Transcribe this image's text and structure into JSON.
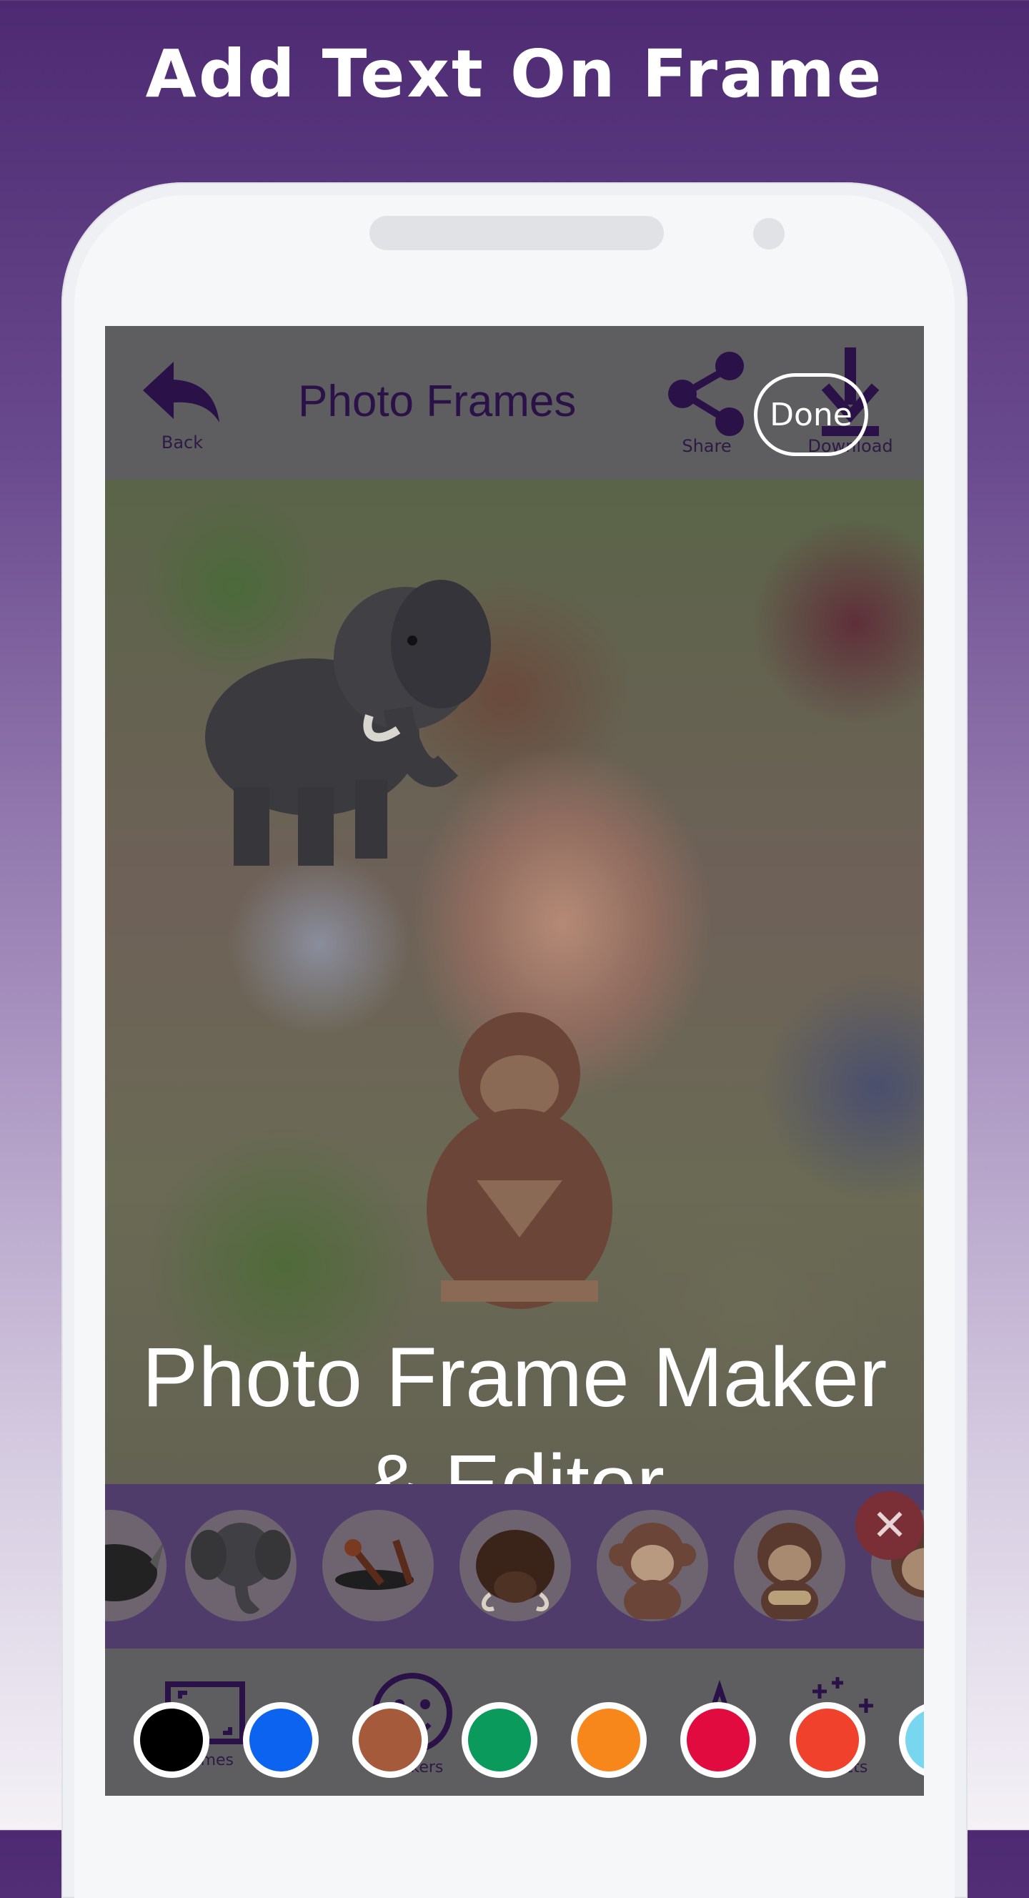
{
  "headline": "Add Text On Frame",
  "app": {
    "title": "Photo Frames",
    "back_label": "Back",
    "share_label": "Share",
    "download_label": "Download",
    "done_label": "Done"
  },
  "overlay_text": {
    "line1": "Photo Frame Maker",
    "line2": "& Editor"
  },
  "stickers": [
    "rhino-sticker",
    "elephant-sticker",
    "grasshopper-sticker",
    "warthog-sticker",
    "monkey-sticker",
    "monkey-sticker-2",
    "monkey-sticker-3"
  ],
  "bottom_nav": [
    {
      "label": "Frames",
      "icon": "frame-icon"
    },
    {
      "label": "Stickers",
      "icon": "smiley-icon"
    },
    {
      "label": "Texts",
      "icon": "text-icon"
    },
    {
      "label": "Effects",
      "icon": "sparkle-icon"
    }
  ],
  "color_swatches": [
    "#000000",
    "#0b63f0",
    "#a65a3c",
    "#0a9a5c",
    "#f7861b",
    "#e10b3f",
    "#f0412c",
    "#78d6ee"
  ],
  "colors": {
    "accent_purple": "#4d2a72",
    "toolbar_text": "#2a1147"
  }
}
